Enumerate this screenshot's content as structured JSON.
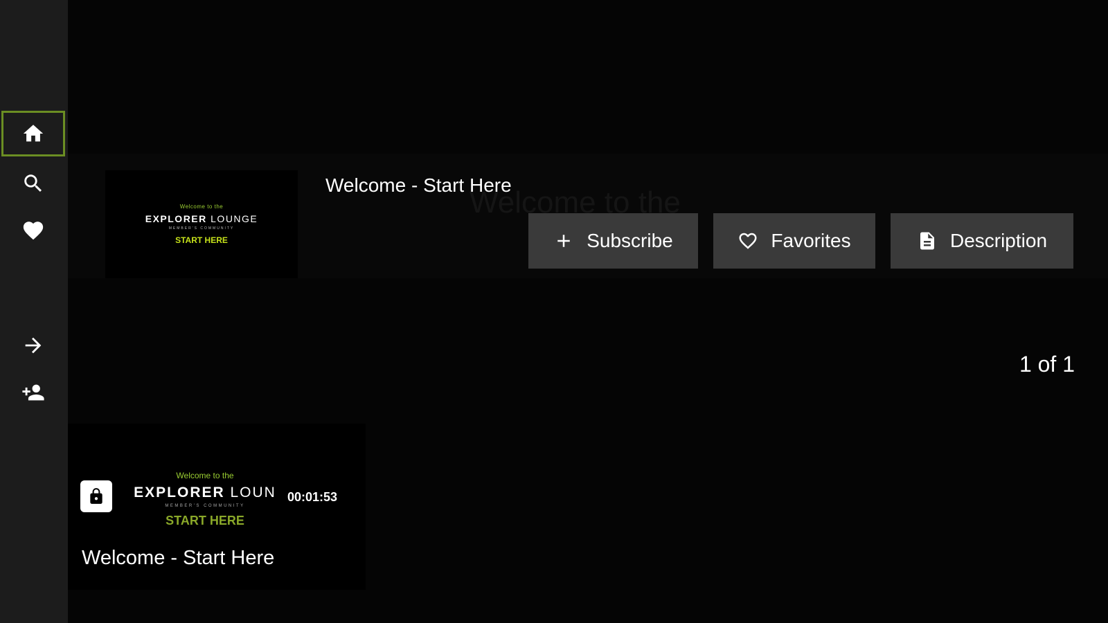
{
  "sidebar": {
    "items": [
      {
        "name": "home",
        "icon": "home-icon",
        "active": true
      },
      {
        "name": "search",
        "icon": "search-icon",
        "active": false
      },
      {
        "name": "favorites",
        "icon": "heart-icon",
        "active": false
      },
      {
        "name": "sign-in",
        "icon": "arrow-right-icon",
        "active": false
      },
      {
        "name": "sign-up",
        "icon": "add-person-icon",
        "active": false
      }
    ]
  },
  "hero": {
    "title": "Welcome - Start Here",
    "watermark": "Welcome to the",
    "thumbnail": {
      "welcome": "Welcome to the",
      "brand_bold": "EXPLORER",
      "brand_light": " LOUNGE",
      "subtitle": "MEMBER'S COMMUNITY",
      "start": "START HERE"
    },
    "buttons": {
      "subscribe": "Subscribe",
      "favorites": "Favorites",
      "description": "Description"
    }
  },
  "pager": "1 of 1",
  "card": {
    "welcome": "Welcome to the",
    "brand_bold": "EXPLORER",
    "brand_light": " LOUN",
    "subtitle": "MEMBER'S COMMUNITY",
    "start": "START HERE",
    "duration": "00:01:53",
    "title": "Welcome - Start Here",
    "locked": true
  },
  "colors": {
    "accent": "#c6e21a",
    "focus_border": "#6b8e23",
    "sidebar_bg": "#1c1c1c",
    "button_bg": "#3a3a3a"
  }
}
